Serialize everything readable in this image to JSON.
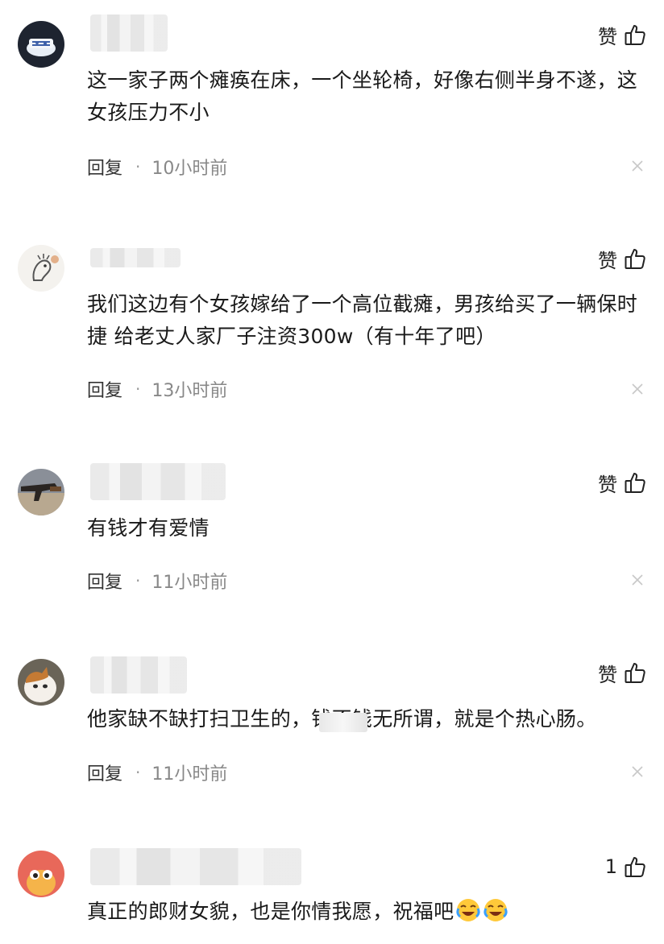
{
  "like_label": "赞",
  "reply_label": "回复",
  "separator": "·",
  "comments": [
    {
      "text": "这一家子两个瘫痪在床，一个坐轮椅，好像右侧半身不遂，这女孩压力不小",
      "time": "10小时前",
      "like": "赞"
    },
    {
      "text": "我们这边有个女孩嫁给了一个高位截瘫，男孩给买了一辆保时捷 给老丈人家厂子注资300w（有十年了吧）",
      "time": "13小时前",
      "like": "赞"
    },
    {
      "text": "有钱才有爱情",
      "time": "11小时前",
      "like": "赞"
    },
    {
      "text": "他家缺不缺打扫卫生的，钱不钱无所谓，就是个热心肠。",
      "time": "11小时前",
      "like": "赞"
    },
    {
      "text": "真正的郎财女貌，也是你情我愿，祝福吧",
      "time": "",
      "like": "1"
    }
  ],
  "icons": {
    "thumb": "thumbs-up-icon",
    "close": "close-icon",
    "emoji": "crying-laughing-emoji"
  },
  "colors": {
    "text": "#1a1a1a",
    "time": "#888888",
    "background": "#ffffff"
  }
}
